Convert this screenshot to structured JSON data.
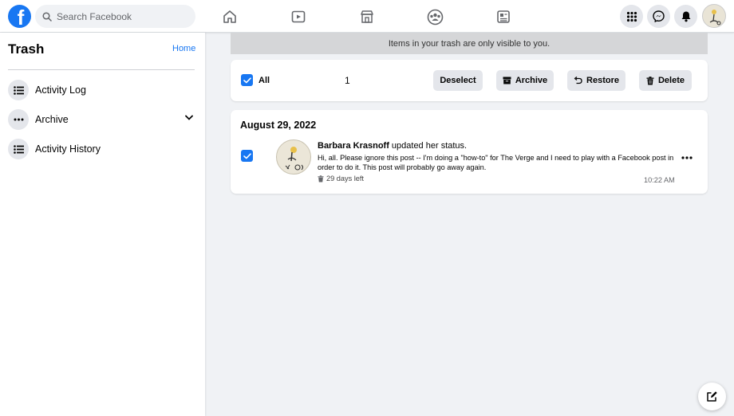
{
  "header": {
    "search_placeholder": "Search Facebook",
    "logo_letter": "f",
    "nav": [
      "home-icon",
      "watch-icon",
      "marketplace-icon",
      "groups-icon",
      "news-icon"
    ],
    "right": [
      "menu-grid-icon",
      "messenger-icon",
      "notifications-icon",
      "profile-avatar"
    ]
  },
  "sidebar": {
    "title": "Trash",
    "home_link": "Home",
    "items": [
      {
        "label": "Activity Log",
        "icon": "list-icon"
      },
      {
        "label": "Archive",
        "icon": "more-horizontal-icon"
      },
      {
        "label": "Activity History",
        "icon": "list-icon"
      }
    ]
  },
  "main": {
    "banner": "Items in your trash are only visible to you.",
    "toolbar": {
      "all_label": "All",
      "selected_count": "1",
      "deselect": "Deselect",
      "archive": "Archive",
      "restore": "Restore",
      "delete": "Delete"
    },
    "group": {
      "date": "August 29, 2022",
      "post": {
        "author": "Barbara Krasnoff",
        "action": " updated her status.",
        "text": "Hi, all. Please ignore this post -- I'm doing a \"how-to\" for The Verge and I need to play with a Facebook post in order to do it. This post will probably go away again.",
        "days_left": "29 days left",
        "time": "10:22 AM"
      }
    }
  },
  "colors": {
    "accent": "#1877f2",
    "button_bg": "#e4e6eb",
    "page_bg": "#f0f2f5"
  }
}
